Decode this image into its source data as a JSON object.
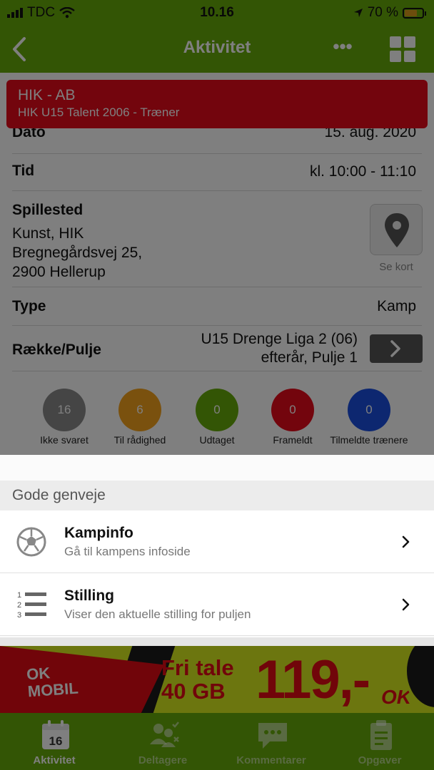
{
  "status_bar": {
    "carrier": "TDC",
    "time": "10.16",
    "battery": "70 %",
    "battery_level": 0.7
  },
  "nav": {
    "title": "Aktivitet",
    "back_icon": "chevron-left-icon",
    "more_icon": "more-dots-icon",
    "more_glyph": "•••",
    "grid_icon": "grid-icon"
  },
  "event": {
    "title": "HIK - AB",
    "subtitle": "HIK U15 Talent 2006 - Træner"
  },
  "details": {
    "date": {
      "label": "Dato",
      "value": "15. aug. 2020"
    },
    "time": {
      "label": "Tid",
      "value": "kl. 10:00 - 11:10"
    },
    "venue": {
      "label": "Spillested",
      "line1": "Kunst, HIK",
      "line2": "Bregnegårdsvej 25,",
      "line3": "2900 Hellerup",
      "map_label": "Se kort"
    },
    "type": {
      "label": "Type",
      "value": "Kamp"
    },
    "division": {
      "label": "Række/Pulje",
      "line1": "U15 Drenge Liga 2 (06)",
      "line2": "efterår, Pulje 1"
    }
  },
  "stats": [
    {
      "count": "16",
      "label": "Ikke svaret",
      "color": "#8a8a8a"
    },
    {
      "count": "6",
      "label": "Til rådighed",
      "color": "#f5a21c"
    },
    {
      "count": "0",
      "label": "Udtaget",
      "color": "#66aa0a"
    },
    {
      "count": "0",
      "label": "Frameldt",
      "color": "#e60b1a"
    },
    {
      "count": "0",
      "label": "Tilmeldte trænere",
      "color": "#1a4fe0"
    }
  ],
  "sheet": {
    "section_title": "Gode genveje",
    "items": [
      {
        "title": "Kampinfo",
        "subtitle": "Gå til kampens infoside",
        "icon": "soccer-ball-icon"
      },
      {
        "title": "Stilling",
        "subtitle": "Viser den aktuelle stilling for puljen",
        "icon": "ranked-list-icon"
      }
    ],
    "list_numbers": [
      "1",
      "2",
      "3"
    ]
  },
  "ad": {
    "brand": "OK MOBIL",
    "brand_line1": "OK",
    "brand_line2": "MOBIL",
    "offer_line1": "Fri tale",
    "offer_line2": "40 GB",
    "price": "119,-",
    "suffix": "OK"
  },
  "tabbar": {
    "calendar_day": "16",
    "tabs": [
      {
        "label": "Aktivitet",
        "icon": "calendar-icon",
        "active": true
      },
      {
        "label": "Deltagere",
        "icon": "participants-icon",
        "active": false
      },
      {
        "label": "Kommentarer",
        "icon": "comments-icon",
        "active": false
      },
      {
        "label": "Opgaver",
        "icon": "tasks-icon",
        "active": false
      }
    ]
  },
  "colors": {
    "brand_green": "#66aa0a",
    "event_red": "#e60b1a",
    "ad_yellow": "#d8ec1e"
  }
}
